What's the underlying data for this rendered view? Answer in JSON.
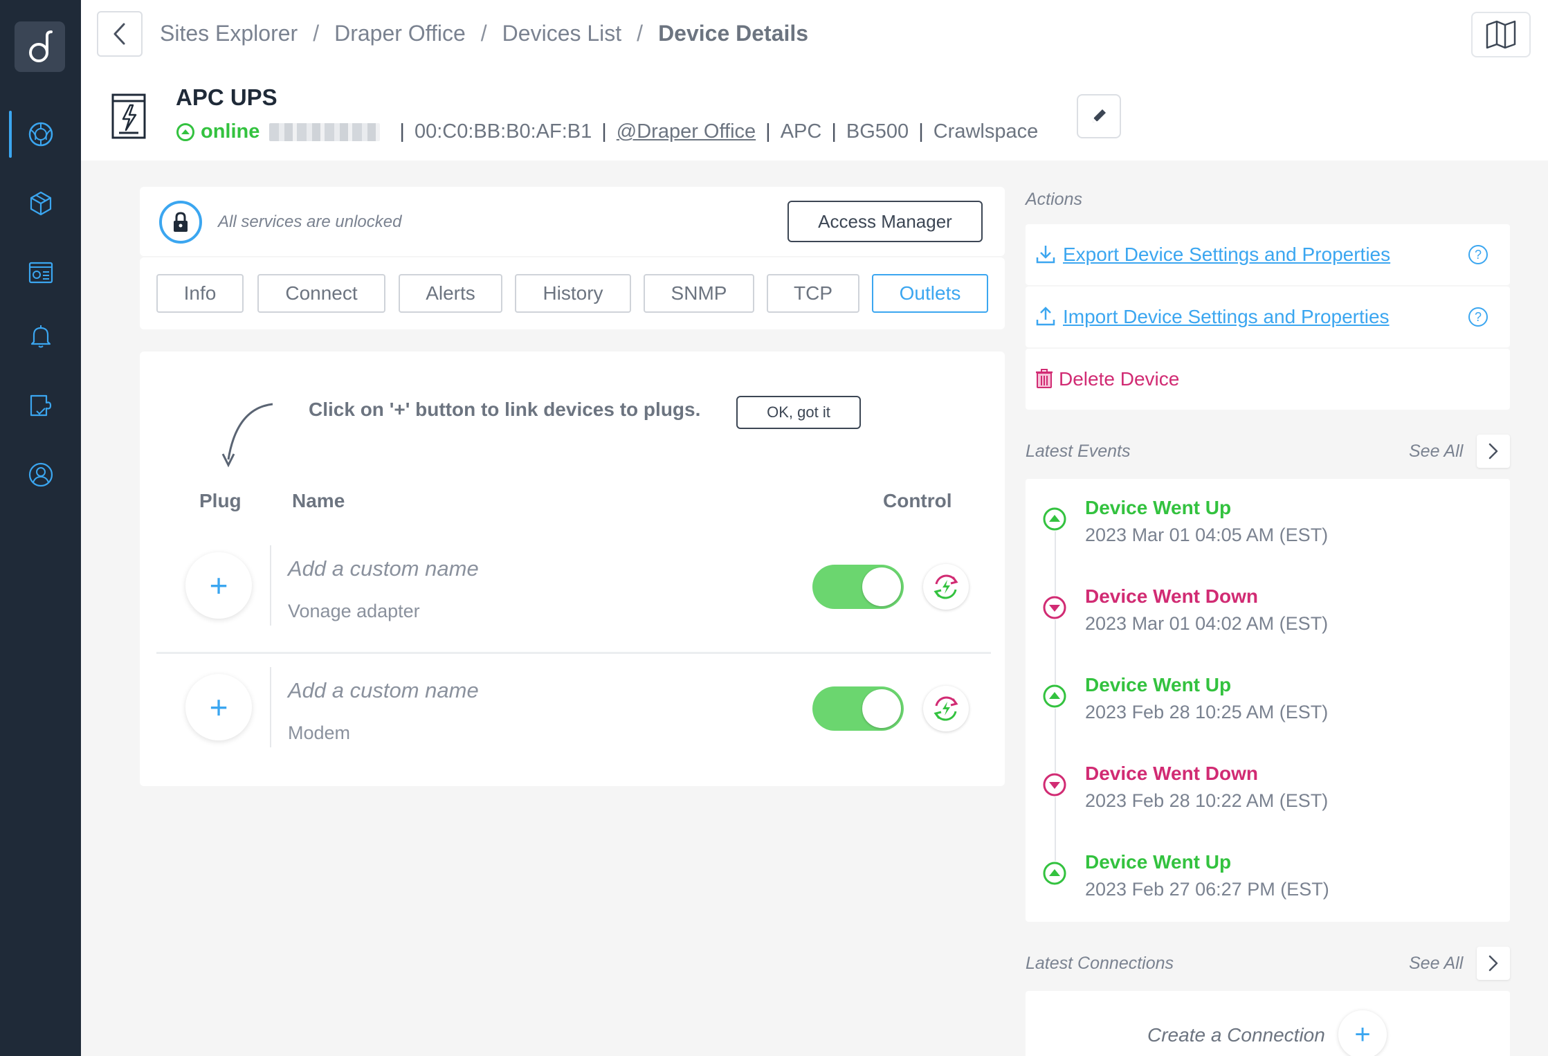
{
  "sidebar": {
    "items": [
      {
        "name": "sites-globe-icon",
        "active": true
      },
      {
        "name": "devices-cube-icon",
        "active": false
      },
      {
        "name": "dashboard-icon",
        "active": false
      },
      {
        "name": "alerts-bell-icon",
        "active": false
      },
      {
        "name": "integrations-icon",
        "active": false
      },
      {
        "name": "account-icon",
        "active": false
      }
    ]
  },
  "breadcrumb": {
    "items": [
      "Sites Explorer",
      "Draper Office",
      "Devices List"
    ],
    "separator": "/",
    "current": "Device Details"
  },
  "device": {
    "name": "APC UPS",
    "status": "online",
    "mac": "00:C0:BB:B0:AF:B1",
    "site": "@Draper Office",
    "vendor": "APC",
    "model": "BG500",
    "location": "Crawlspace",
    "status_color": "#33c23f"
  },
  "lock": {
    "text": "All services are unlocked",
    "access_manager_label": "Access Manager"
  },
  "tabs": [
    {
      "label": "Info",
      "active": false
    },
    {
      "label": "Connect",
      "active": false
    },
    {
      "label": "Alerts",
      "active": false
    },
    {
      "label": "History",
      "active": false
    },
    {
      "label": "SNMP",
      "active": false
    },
    {
      "label": "TCP",
      "active": false
    },
    {
      "label": "Outlets",
      "active": true
    }
  ],
  "outlets": {
    "hint": "Click on '+' button to link devices to plugs.",
    "ok_label": "OK, got it",
    "columns": {
      "plug": "Plug",
      "name": "Name",
      "control": "Control"
    },
    "rows": [
      {
        "placeholder": "Add a custom name",
        "device": "Vonage adapter",
        "on": true
      },
      {
        "placeholder": "Add a custom name",
        "device": "Modem",
        "on": true
      }
    ],
    "plus_glyph": "+"
  },
  "actions": {
    "label": "Actions",
    "export_label": "Export Device Settings and Properties",
    "import_label": "Import Device Settings and Properties",
    "delete_label": "Delete Device",
    "help_glyph": "?"
  },
  "events": {
    "label": "Latest Events",
    "see_all": "See All",
    "items": [
      {
        "type": "up",
        "title": "Device Went Up",
        "time": "2023 Mar 01 04:05 AM (EST)"
      },
      {
        "type": "down",
        "title": "Device Went Down",
        "time": "2023 Mar 01 04:02 AM (EST)"
      },
      {
        "type": "up",
        "title": "Device Went Up",
        "time": "2023 Feb 28 10:25 AM (EST)"
      },
      {
        "type": "down",
        "title": "Device Went Down",
        "time": "2023 Feb 28 10:22 AM (EST)"
      },
      {
        "type": "up",
        "title": "Device Went Up",
        "time": "2023 Feb 27 06:27 PM (EST)"
      }
    ]
  },
  "connections": {
    "label": "Latest Connections",
    "see_all": "See All",
    "create_label": "Create a Connection",
    "plus_glyph": "+"
  },
  "colors": {
    "accent": "#3ba6f0",
    "up": "#33c23f",
    "down": "#d12b73",
    "sidebar": "#1f2a38"
  }
}
